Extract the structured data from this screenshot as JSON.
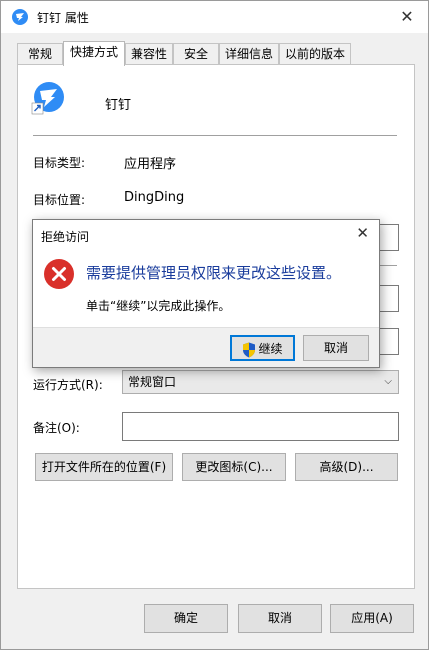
{
  "window": {
    "title": "钉钉 属性"
  },
  "tabs": [
    {
      "label": "常规"
    },
    {
      "label": "快捷方式"
    },
    {
      "label": "兼容性"
    },
    {
      "label": "安全"
    },
    {
      "label": "详细信息"
    },
    {
      "label": "以前的版本"
    }
  ],
  "shortcut": {
    "app_name": "钉钉",
    "target_type_label": "目标类型:",
    "target_type_value": "应用程序",
    "target_location_label": "目标位置:",
    "target_location_value": "DingDing",
    "run_label": "运行方式(R):",
    "run_value": "常规窗口",
    "comment_label": "备注(O):",
    "comment_value": "",
    "open_location_btn": "打开文件所在的位置(F)",
    "change_icon_btn": "更改图标(C)...",
    "advanced_btn": "高级(D)..."
  },
  "footer": {
    "ok": "确定",
    "cancel": "取消",
    "apply": "应用(A)"
  },
  "dialog": {
    "title": "拒绝访问",
    "message": "需要提供管理员权限来更改这些设置。",
    "sub": "单击“继续”以完成此操作。",
    "continue": "继续",
    "cancel": "取消"
  },
  "colors": {
    "accent_text": "#1a3c9c",
    "error_red": "#d9302a",
    "dingding_blue": "#2f8cf5"
  },
  "icons": {
    "title": "dingding-icon",
    "error": "error-circle-icon",
    "shield": "uac-shield-icon"
  }
}
